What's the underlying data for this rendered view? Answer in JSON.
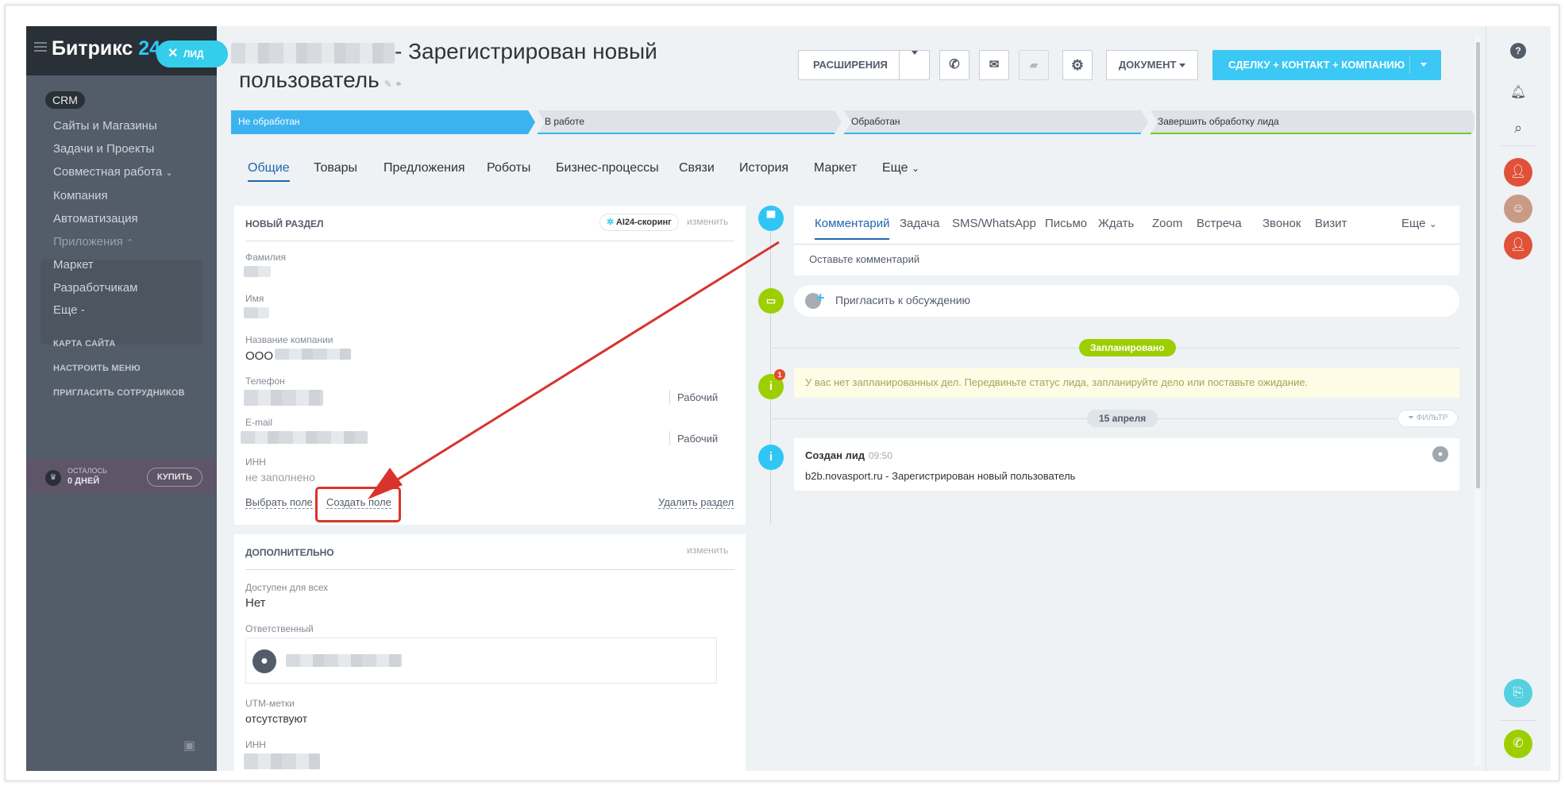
{
  "leftmenu": {
    "logo_main": "Битрикс",
    "logo_num": "24",
    "lead_pill": "ЛИД",
    "crm": "CRM",
    "items": [
      "Сайты и Магазины",
      "Задачи и Проекты",
      "Совместная работа",
      "Компания",
      "Автоматизация"
    ],
    "apps": "Приложения",
    "apps_items": [
      "Маркет",
      "Разработчикам"
    ],
    "more": "Еще -",
    "small_links": [
      "КАРТА САЙТА",
      "НАСТРОИТЬ МЕНЮ",
      "ПРИГЛАСИТЬ СОТРУДНИКОВ"
    ],
    "trial_l1": "ОСТАЛОСЬ",
    "trial_l2": "0 ДНЕЙ",
    "buy": "КУПИТЬ"
  },
  "header": {
    "title_suffix": "- Зарегистрирован новый",
    "title_line2": "пользователь",
    "btn_extensions": "РАСШИРЕНИЯ",
    "btn_document": "ДОКУМЕНТ",
    "btn_convert": "СДЕЛКУ + КОНТАКТ + КОМПАНИЮ"
  },
  "stages": [
    "Не обработан",
    "В работе",
    "Обработан",
    "Завершить обработку лида"
  ],
  "tabs": [
    "Общие",
    "Товары",
    "Предложения",
    "Роботы",
    "Бизнес-процессы",
    "Связи",
    "История",
    "Маркет",
    "Еще"
  ],
  "section1": {
    "title": "НОВЫЙ РАЗДЕЛ",
    "scoring": "AI24-скоринг",
    "edit": "изменить",
    "labels": {
      "lastname": "Фамилия",
      "name": "Имя",
      "company": "Название компании",
      "phone": "Телефон",
      "email": "E-mail",
      "inn": "ИНН"
    },
    "company_prefix": "ООО",
    "phone_type": "Рабочий",
    "email_type": "Рабочий",
    "inn_value": "не заполнено",
    "select_field": "Выбрать поле",
    "create_field": "Создать поле",
    "delete_section": "Удалить раздел"
  },
  "section2": {
    "title": "ДОПОЛНИТЕЛЬНО",
    "edit": "изменить",
    "available_label": "Доступен для всех",
    "available_value": "Нет",
    "responsible_label": "Ответственный",
    "utm_label": "UTM-метки",
    "utm_value": "отсутствуют",
    "inn_label": "ИНН"
  },
  "timeline": {
    "tabs": [
      "Комментарий",
      "Задача",
      "SMS/WhatsApp",
      "Письмо",
      "Ждать",
      "Zoom",
      "Встреча",
      "Звонок",
      "Визит"
    ],
    "more": "Еще",
    "comment_placeholder": "Оставьте комментарий",
    "invite": "Пригласить к обсуждению",
    "planned": "Запланировано",
    "notice_badge": "1",
    "notice": "У вас нет запланированных дел. Передвиньте статус лида, запланируйте дело или поставьте ожидание.",
    "date_pill": "15 апреля",
    "filter": "ФИЛЬТР",
    "created_title": "Создан лид",
    "created_time": "09:50",
    "created_text": "b2b.novasport.ru - Зарегистрирован новый пользователь"
  },
  "colors": {
    "accent": "#3bc8f5",
    "active_tab": "#2066b0",
    "annotation": "#d8342c",
    "green": "#9dcf00"
  }
}
